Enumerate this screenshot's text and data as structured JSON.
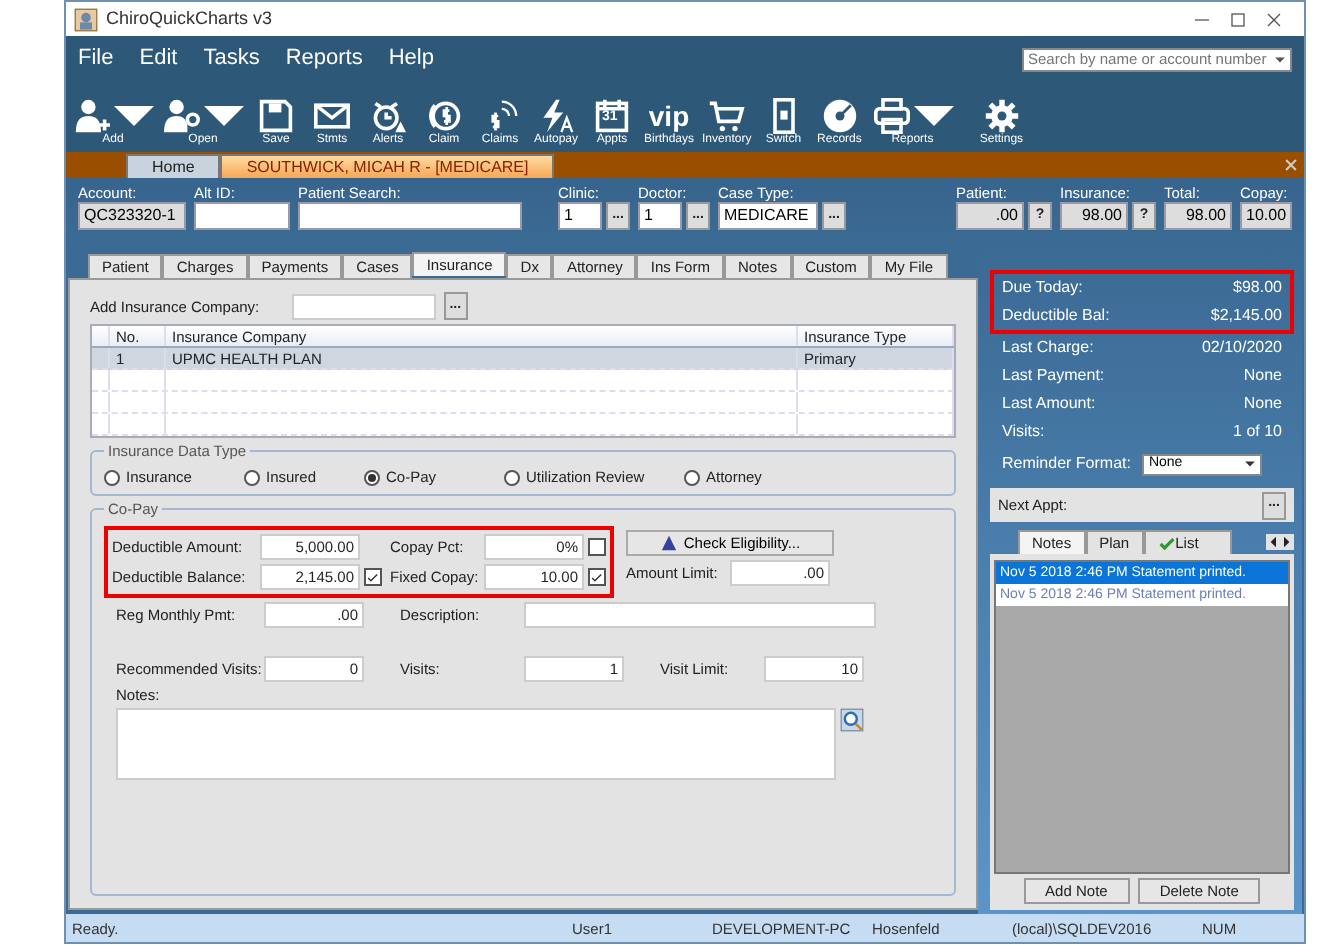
{
  "window": {
    "title": "ChiroQuickCharts v3"
  },
  "menu": [
    "File",
    "Edit",
    "Tasks",
    "Reports",
    "Help"
  ],
  "search": {
    "placeholder": "Search by name or account number"
  },
  "toolbar": [
    {
      "label": "Add",
      "kind": "person-add",
      "dropdown": true
    },
    {
      "label": "Open",
      "kind": "person-search",
      "dropdown": true
    },
    {
      "label": "Save",
      "kind": "floppy",
      "dropdown": false
    },
    {
      "label": "Stmts",
      "kind": "envelope",
      "dropdown": false
    },
    {
      "label": "Alerts",
      "kind": "alarm",
      "dropdown": false
    },
    {
      "label": "Claim",
      "kind": "dollar-circle",
      "dropdown": false
    },
    {
      "label": "Claims",
      "kind": "dollar-signal",
      "dropdown": false
    },
    {
      "label": "Autopay",
      "kind": "lightning",
      "dropdown": false
    },
    {
      "label": "Appts",
      "kind": "calendar",
      "icon_text": "31",
      "dropdown": false
    },
    {
      "label": "Birthdays",
      "kind": "text",
      "icon_text": "vip",
      "dropdown": false
    },
    {
      "label": "Inventory",
      "kind": "cart",
      "dropdown": false
    },
    {
      "label": "Switch",
      "kind": "switch",
      "dropdown": false
    },
    {
      "label": "Records",
      "kind": "disc",
      "dropdown": false
    },
    {
      "label": "Reports",
      "kind": "printer",
      "dropdown": true
    },
    {
      "label": "Settings",
      "kind": "gear",
      "dropdown": false
    }
  ],
  "doc_tabs": [
    {
      "label": "Home",
      "selected": false
    },
    {
      "label": "SOUTHWICK, MICAH R - [MEDICARE]",
      "selected": true
    }
  ],
  "header": [
    {
      "label": "Account:",
      "value": "QC323320-1",
      "kind": "readonly"
    },
    {
      "label": "Alt ID:",
      "kind": "text"
    },
    {
      "label": "Patient Search:",
      "kind": "wide"
    },
    {
      "label": "Clinic:",
      "value": "1",
      "kind": "lookup",
      "button": "..."
    },
    {
      "label": "Doctor:",
      "value": "1",
      "kind": "lookup",
      "button": "..."
    },
    {
      "label": "Case Type:",
      "value": "MEDICARE",
      "kind": "lookup-wide",
      "button": "..."
    },
    {
      "label": "Patient:",
      "value": ".00",
      "kind": "amount",
      "button": "?"
    },
    {
      "label": "Insurance:",
      "value": "98.00",
      "kind": "amount",
      "button": "?"
    },
    {
      "label": "Total:",
      "value": "98.00",
      "kind": "amount"
    },
    {
      "label": "Copay:",
      "value": "10.00",
      "kind": "small-amount"
    }
  ],
  "tabs": [
    {
      "label": "Patient",
      "selected": false
    },
    {
      "label": "Charges",
      "selected": false
    },
    {
      "label": "Payments",
      "selected": false
    },
    {
      "label": "Cases",
      "selected": false
    },
    {
      "label": "Insurance",
      "selected": true
    },
    {
      "label": "Dx",
      "selected": false
    },
    {
      "label": "Attorney",
      "selected": false
    },
    {
      "label": "Ins Form",
      "selected": false
    },
    {
      "label": "Notes",
      "selected": false
    },
    {
      "label": "Custom",
      "selected": false
    },
    {
      "label": "My File",
      "selected": false
    }
  ],
  "add_insurance": {
    "label": "Add Insurance Company:",
    "button": "..."
  },
  "table": {
    "columns": [
      "No.",
      "Insurance Company",
      "Insurance Type"
    ],
    "rows": [
      {
        "cells": [
          "1",
          "UPMC HEALTH PLAN",
          "Primary"
        ],
        "selected": true
      }
    ]
  },
  "data_type": {
    "title": "Insurance Data Type",
    "options": [
      {
        "label": "Insurance",
        "selected": false
      },
      {
        "label": "Insured",
        "selected": false
      },
      {
        "label": "Co-Pay",
        "selected": true
      },
      {
        "label": "Utilization Review",
        "selected": false
      },
      {
        "label": "Attorney",
        "selected": false
      }
    ]
  },
  "copay": {
    "title": "Co-Pay",
    "highlighted": true,
    "boxed_rows": [
      [
        {
          "label": "Deductible Amount:",
          "value": "5,000.00"
        },
        {
          "label": "Copay Pct:",
          "value": "0%",
          "checked": false
        }
      ],
      [
        {
          "label": "Deductible Balance:",
          "value": "2,145.00",
          "checked": true
        },
        {
          "label": "Fixed Copay:",
          "value": "10.00",
          "checked": true
        }
      ]
    ],
    "eligibility_button": "Check Eligibility...",
    "amount_limit": {
      "label": "Amount Limit:",
      "value": ".00"
    },
    "monthly": {
      "label": "Reg Monthly Pmt:",
      "value": ".00"
    },
    "description": {
      "label": "Description:"
    },
    "visits": [
      {
        "label": "Recommended Visits:",
        "value": "0"
      },
      {
        "label": "Visits:",
        "value": "1"
      },
      {
        "label": "Visit Limit:",
        "value": "10"
      }
    ],
    "notes_label": "Notes:"
  },
  "summary": [
    {
      "label": "Due Today:",
      "value": "$98.00",
      "highlighted": true
    },
    {
      "label": "Deductible Bal:",
      "value": "$2,145.00",
      "highlighted": true
    },
    {
      "label": "Last Charge:",
      "value": "02/10/2020",
      "highlighted": false
    },
    {
      "label": "Last Payment:",
      "value": "None",
      "highlighted": false
    },
    {
      "label": "Last Amount:",
      "value": "None",
      "highlighted": false
    },
    {
      "label": "Visits:",
      "value": "1 of  10",
      "highlighted": false
    }
  ],
  "reminder": {
    "label": "Reminder Format:",
    "value": "None"
  },
  "next_appt": {
    "label": "Next Appt:",
    "button": "..."
  },
  "note_tabs": [
    {
      "label": "Notes",
      "selected": true
    },
    {
      "label": "Plan",
      "selected": false
    },
    {
      "label": "List",
      "selected": false,
      "icon": true
    }
  ],
  "notes": [
    {
      "text": "Nov 5 2018 2:46 PM Statement printed.",
      "selected": true
    },
    {
      "text": "Nov 5 2018 2:46 PM Statement printed.",
      "selected": false
    }
  ],
  "note_buttons": [
    "Add Note",
    "Delete Note"
  ],
  "status_bar": [
    "Ready.",
    "User1",
    "DEVELOPMENT-PC",
    "Hosenfeld",
    "(local)\\SQLDEV2016",
    "NUM"
  ]
}
